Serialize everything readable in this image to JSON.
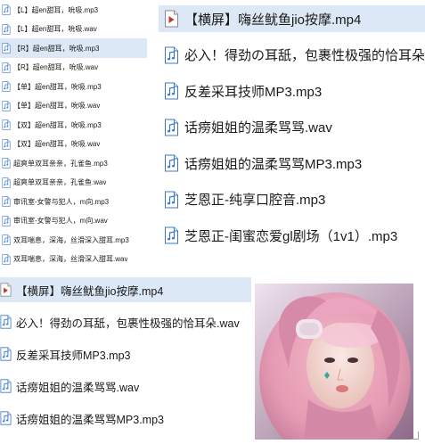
{
  "left_list": [
    {
      "label": "【L】超en甜耳，吮吸.mp3",
      "icon": "audio-file-icon",
      "selected": false
    },
    {
      "label": "【L】超en甜耳，吮吸.wav",
      "icon": "audio-file-icon",
      "selected": false
    },
    {
      "label": "【R】超en甜耳，吮吸.mp3",
      "icon": "audio-file-icon",
      "selected": true
    },
    {
      "label": "【R】超en甜耳，吮吸.wav",
      "icon": "audio-file-icon",
      "selected": false
    },
    {
      "label": "【单】超en甜耳，吮吸.mp3",
      "icon": "audio-file-icon",
      "selected": false
    },
    {
      "label": "【单】超en甜耳，吮吸.wav",
      "icon": "audio-file-icon",
      "selected": false
    },
    {
      "label": "【双】超en甜耳，吮吸.mp3",
      "icon": "audio-file-icon",
      "selected": false
    },
    {
      "label": "【双】超en甜耳，吮吸.wav",
      "icon": "audio-file-icon",
      "selected": false
    },
    {
      "label": "超爽单双耳亲亲，孔雀鱼.mp3",
      "icon": "audio-file-icon",
      "selected": false
    },
    {
      "label": "超爽单双耳亲亲，孔雀鱼.wav",
      "icon": "audio-file-icon",
      "selected": false
    },
    {
      "label": "审讯室-女警与犯人，m向.mp3",
      "icon": "audio-file-icon",
      "selected": false
    },
    {
      "label": "审讯室-女警与犯人，m向.wav",
      "icon": "audio-file-icon",
      "selected": false
    },
    {
      "label": "双耳喘息，深海，丝滑深入甜耳.mp3",
      "icon": "audio-file-icon",
      "selected": false
    },
    {
      "label": "双耳喘息，深海，丝滑深入甜耳.wav",
      "icon": "audio-file-icon",
      "selected": false
    }
  ],
  "right_list": [
    {
      "label": "【横屏】嗨丝鱿鱼jio按摩.mp4",
      "icon": "video-file-icon",
      "selected": true
    },
    {
      "label": "必入！得劲の耳舐，包裹性极强的恰耳朵.",
      "icon": "audio-file-icon",
      "selected": false
    },
    {
      "label": "反差采耳技师MP3.mp3",
      "icon": "audio-file-icon",
      "selected": false
    },
    {
      "label": "话痨姐姐的温柔骂骂.wav",
      "icon": "audio-file-icon",
      "selected": false
    },
    {
      "label": "话痨姐姐的温柔骂骂MP3.mp3",
      "icon": "audio-file-icon",
      "selected": false
    },
    {
      "label": "芝恩正-纯享口腔音.mp3",
      "icon": "audio-file-icon",
      "selected": false
    },
    {
      "label": "芝恩正-闺蜜恋爱gl剧场（1v1）.mp3",
      "icon": "audio-file-icon",
      "selected": false
    }
  ],
  "bottom_list": [
    {
      "label": "【横屏】嗨丝鱿鱼jio按摩.mp4",
      "icon": "video-file-icon",
      "selected": true
    },
    {
      "label": "必入！得劲の耳舐，包裹性极强的恰耳朵.wav",
      "icon": "audio-file-icon",
      "selected": false
    },
    {
      "label": "反差采耳技师MP3.mp3",
      "icon": "audio-file-icon",
      "selected": false
    },
    {
      "label": "话痨姐姐的温柔骂骂.wav",
      "icon": "audio-file-icon",
      "selected": false
    },
    {
      "label": "话痨姐姐的温柔骂骂MP3.mp3",
      "icon": "audio-file-icon",
      "selected": false
    }
  ],
  "colors": {
    "selection": "#dde8f6",
    "icon_blue": "#3b78c4",
    "icon_red": "#c0392b",
    "text": "#1a1a1a"
  }
}
